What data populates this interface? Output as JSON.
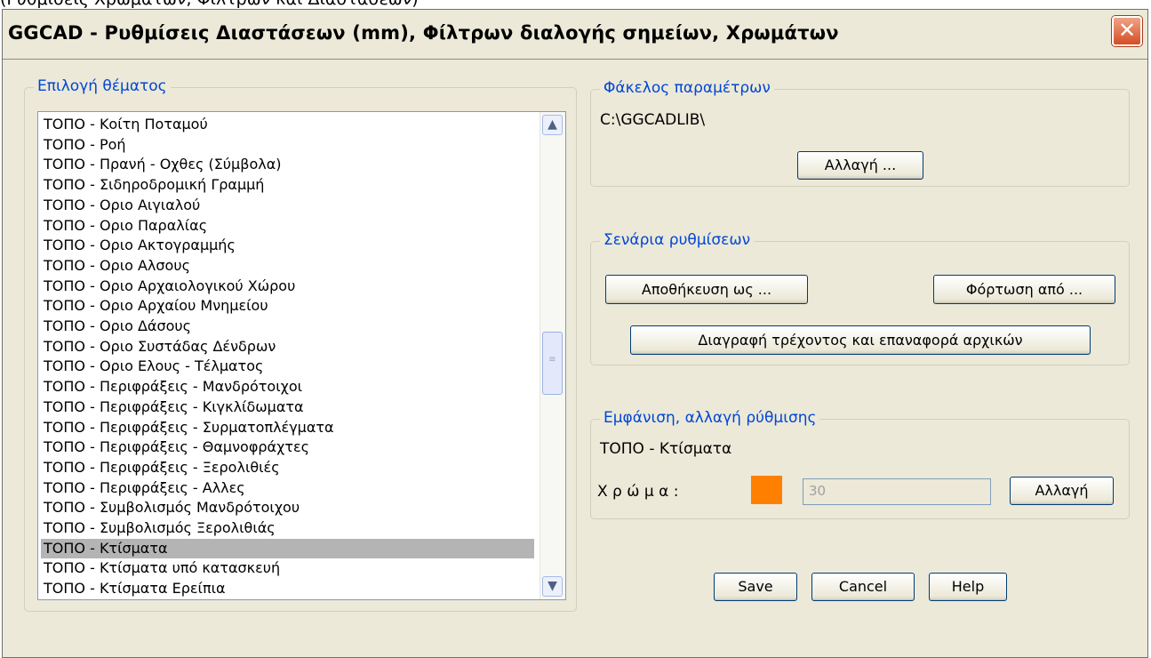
{
  "top_strip_text": "(Ρυθμίσεις Χρωμάτων, Φίλτρων και Διαστάσεων)",
  "window": {
    "title": "GGCAD - Ρυθμίσεις Διαστάσεων (mm), Φίλτρων διαλογής σημείων, Χρωμάτων",
    "close_glyph": "✕"
  },
  "theme_select": {
    "title": "Επιλογή θέματος",
    "selected_index": 21,
    "items": [
      "ΤΟΠΟ - Κοίτη Ποταμού",
      "ΤΟΠΟ - Ροή",
      "ΤΟΠΟ - Πρανή - Οχθες (Σύμβολα)",
      "ΤΟΠΟ - Σιδηροδρομική Γραμμή",
      "ΤΟΠΟ - Οριο Αιγιαλού",
      "ΤΟΠΟ - Οριο Παραλίας",
      "ΤΟΠΟ - Οριο Ακτογραμμής",
      "ΤΟΠΟ - Οριο Αλσους",
      "ΤΟΠΟ - Οριο Αρχαιολογικού Χώρου",
      "ΤΟΠΟ - Οριο Αρχαίου Μνημείου",
      "ΤΟΠΟ - Οριο Δάσους",
      "ΤΟΠΟ - Οριο Συστάδας Δένδρων",
      "ΤΟΠΟ - Οριο Ελους - Τέλματος",
      "ΤΟΠΟ - Περιφράξεις - Μανδρότοιχοι",
      "ΤΟΠΟ - Περιφράξεις - Κιγκλίδωματα",
      "ΤΟΠΟ - Περιφράξεις - Συρματοπλέγματα",
      "ΤΟΠΟ - Περιφράξεις - Θαμνοφράχτες",
      "ΤΟΠΟ - Περιφράξεις - Ξερολιθιές",
      "ΤΟΠΟ - Περιφράξεις - Αλλες",
      "ΤΟΠΟ - Συμβολισμός Μανδρότοιχου",
      "ΤΟΠΟ - Συμβολισμός Ξερολιθιάς",
      "ΤΟΠΟ - Κτίσματα",
      "ΤΟΠΟ - Κτίσματα υπό κατασκευή",
      "ΤΟΠΟ - Κτίσματα Ερείπια"
    ],
    "scroll_up_glyph": "▲",
    "scroll_down_glyph": "▼"
  },
  "params_folder": {
    "title": "Φάκελος παραμέτρων",
    "path": "C:\\GGCADLIB\\",
    "change_label": "Αλλαγή ..."
  },
  "scenarios": {
    "title": "Σενάρια ρυθμίσεων",
    "save_as_label": "Αποθήκευση ως ...",
    "load_from_label": "Φόρτωση από ...",
    "delete_restore_label": "Διαγραφή τρέχοντος και επαναφορά αρχικών"
  },
  "display_setting": {
    "title": "Εμφάνιση, αλλαγή ρύθμισης",
    "current_theme": "ΤΟΠΟ - Κτίσματα",
    "color_label": "Χ ρ ώ μ α :",
    "color_swatch": "#ff8000",
    "color_value": "30",
    "change_label": "Αλλαγή"
  },
  "footer": {
    "save_label": "Save",
    "cancel_label": "Cancel",
    "help_label": "Help"
  }
}
